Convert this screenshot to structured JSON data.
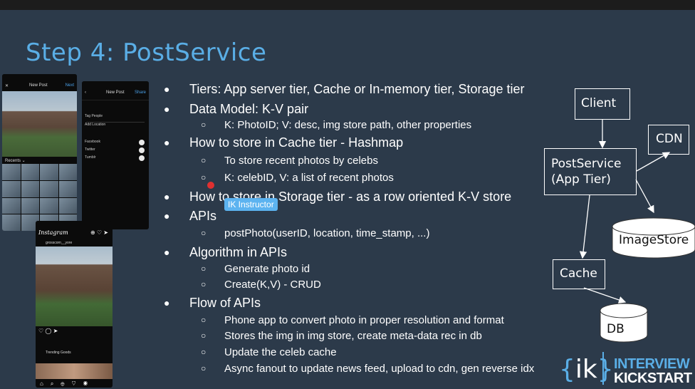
{
  "slide": {
    "title": "Step 4: PostService"
  },
  "bullets": [
    {
      "level": 1,
      "bullet": "●",
      "text": "Tiers: App server tier, Cache or In-memory tier, Storage tier"
    },
    {
      "level": 1,
      "bullet": "●",
      "text": "Data Model: K-V pair"
    },
    {
      "level": 2,
      "bullet": "○",
      "text": "K: PhotoID; V: desc, img store path, other properties"
    },
    {
      "level": 1,
      "bullet": "●",
      "text": "How to store in Cache tier - Hashmap"
    },
    {
      "level": 2,
      "bullet": "○",
      "text": "To store recent photos by celebs"
    },
    {
      "level": 2,
      "bullet": "○",
      "text": "K: celebID, V: a list of recent photos"
    },
    {
      "level": 1,
      "bullet": "●",
      "text": "How to store in Storage tier - as a row oriented K-V store"
    },
    {
      "level": 1,
      "bullet": "●",
      "text": "APIs"
    },
    {
      "level": 2,
      "bullet": "○",
      "text": "postPhoto(userID, location, time_stamp, ...)"
    },
    {
      "level": 1,
      "bullet": "●",
      "text": "Algorithm in APIs"
    },
    {
      "level": 2,
      "bullet": "○",
      "text": "Generate photo id"
    },
    {
      "level": 2,
      "bullet": "○",
      "text": "Create(K,V) - CRUD"
    },
    {
      "level": 1,
      "bullet": "●",
      "text": "Flow of APIs"
    },
    {
      "level": 2,
      "bullet": "○",
      "text": "Phone app to convert photo in proper resolution and format"
    },
    {
      "level": 2,
      "bullet": "○",
      "text": "Stores the img in img store, create meta-data rec in db"
    },
    {
      "level": 2,
      "bullet": "○",
      "text": "Update the celeb cache"
    },
    {
      "level": 2,
      "bullet": "○",
      "text": "Async fanout to update news feed, upload to cdn, gen reverse idx"
    }
  ],
  "tooltip": {
    "text": "IK Instructor"
  },
  "diagram": {
    "client": "Client",
    "cdn": "CDN",
    "postservice_line1": "PostService",
    "postservice_line2": "(App Tier)",
    "imagestore": "ImageStore",
    "cache": "Cache",
    "db": "DB"
  },
  "phones": {
    "p1_title": "New Post",
    "p1_action": "Next",
    "p1_recents": "Recents ⌄",
    "p2_title": "New Post",
    "p2_action": "Share",
    "p2_tag": "Tag People",
    "p2_location": "Add Location",
    "p2_facebook": "Facebook",
    "p2_twitter": "Twitter",
    "p2_tumblr": "Tumblr",
    "p3_logo": "Instagram",
    "p3_user": "grosscorn__yore",
    "p3_trending": "Trending Goods"
  },
  "brand": {
    "mark": "ik",
    "line1": "INTERVIEW",
    "line2": "KICKSTART"
  },
  "colors": {
    "background": "#2c3a4a",
    "title": "#5aaee6",
    "accent": "#5aaee6",
    "tooltip": "#5cb3f0",
    "cursor": "#e03030"
  }
}
